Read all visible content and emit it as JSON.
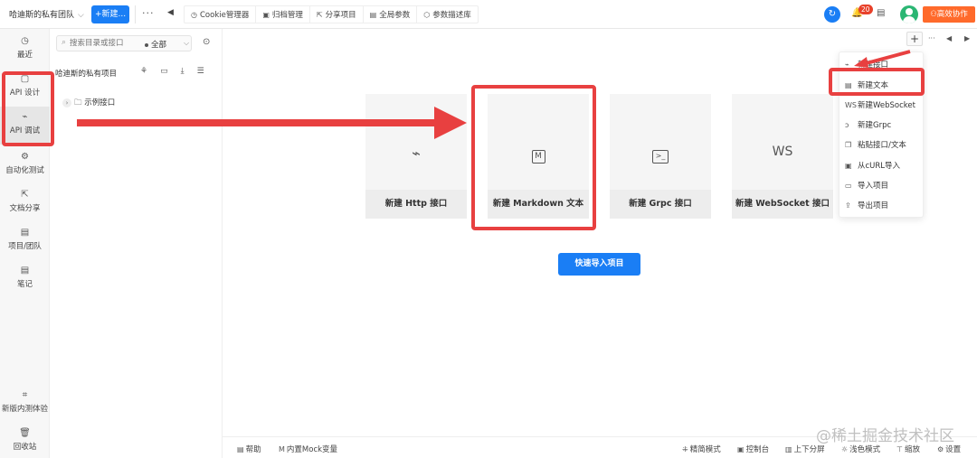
{
  "topbar": {
    "team": "哈迪斯的私有团队",
    "team_caret": "⌵",
    "new_btn": "+新建...",
    "more": "···",
    "back": "◀",
    "tabs": [
      {
        "icon": "◷",
        "label": "Cookie管理器"
      },
      {
        "icon": "▣",
        "label": "归档管理"
      },
      {
        "icon": "⇱",
        "label": "分享项目"
      },
      {
        "icon": "▤",
        "label": "全局参数"
      },
      {
        "icon": "⬡",
        "label": "参数描述库"
      }
    ],
    "sync_icon": "↻",
    "bell": "🔔",
    "badge": "20",
    "doc_icon": "▤",
    "collab": "⚇高效协作"
  },
  "leftnav": [
    {
      "icon": "◷",
      "label": "最近"
    },
    {
      "icon": "▢",
      "label": "API 设计"
    },
    {
      "icon": "⌁",
      "label": "API 调试"
    },
    {
      "icon": "⚙",
      "label": "自动化测试"
    },
    {
      "icon": "⇱",
      "label": "文档分享"
    },
    {
      "icon": "▤",
      "label": "项目/团队"
    },
    {
      "icon": "▤",
      "label": "笔记"
    },
    {
      "icon": "⌗",
      "label": "新版内测体验"
    },
    {
      "icon": "🗑",
      "label": "回收站"
    }
  ],
  "sidebar": {
    "search_placeholder": "搜索目录或接口",
    "filter": "全部",
    "filter_caret": "⌵",
    "search_icon": "⌕",
    "locate_icon": "⊙",
    "project": "哈迪斯的私有项目",
    "project_icons": [
      "⚘",
      "▭",
      "⤓",
      "☰"
    ],
    "tree_chevron": "›",
    "tree_folder": "🗀",
    "tree_item": "示例接口"
  },
  "main": {
    "plus": "+",
    "dots": "···",
    "prev": "◀",
    "next": "▶",
    "cards": [
      {
        "icon": "⌁",
        "label": "新建 Http 接口"
      },
      {
        "icon": "M",
        "label": "新建 Markdown 文本"
      },
      {
        "icon": ">_",
        "label": "新建 Grpc 接口"
      },
      {
        "icon": "WS",
        "label": "新建 WebSocket 接口"
      }
    ],
    "import_btn": "快速导入项目"
  },
  "menu": [
    {
      "icon": "⌁",
      "label": "新建接口"
    },
    {
      "icon": "▤",
      "label": "新建文本"
    },
    {
      "icon": "WS",
      "label": "新建WebSocket"
    },
    {
      "icon": "ↄ",
      "label": "新建Grpc"
    },
    {
      "icon": "❐",
      "label": "粘贴接口/文本"
    },
    {
      "icon": "▣",
      "label": "从cURL导入"
    },
    {
      "icon": "▭",
      "label": "导入项目"
    },
    {
      "icon": "⇪",
      "label": "导出项目"
    }
  ],
  "bottombar": {
    "left": [
      {
        "icon": "▤",
        "label": "帮助"
      },
      {
        "icon": "M",
        "label": "内置Mock变量"
      }
    ],
    "right": [
      {
        "icon": "⁜",
        "label": "精简模式"
      },
      {
        "icon": "▣",
        "label": "控制台"
      },
      {
        "icon": "▥",
        "label": "上下分屏"
      },
      {
        "icon": "☼",
        "label": "浅色模式"
      },
      {
        "icon": "⊤",
        "label": "缩放"
      },
      {
        "icon": "⚙",
        "label": "设置"
      }
    ]
  },
  "watermark": "@稀土掘金技术社区",
  "colors": {
    "accent": "#1a7ef5",
    "collab": "#ff6a2b",
    "highlight": "#e84040"
  }
}
